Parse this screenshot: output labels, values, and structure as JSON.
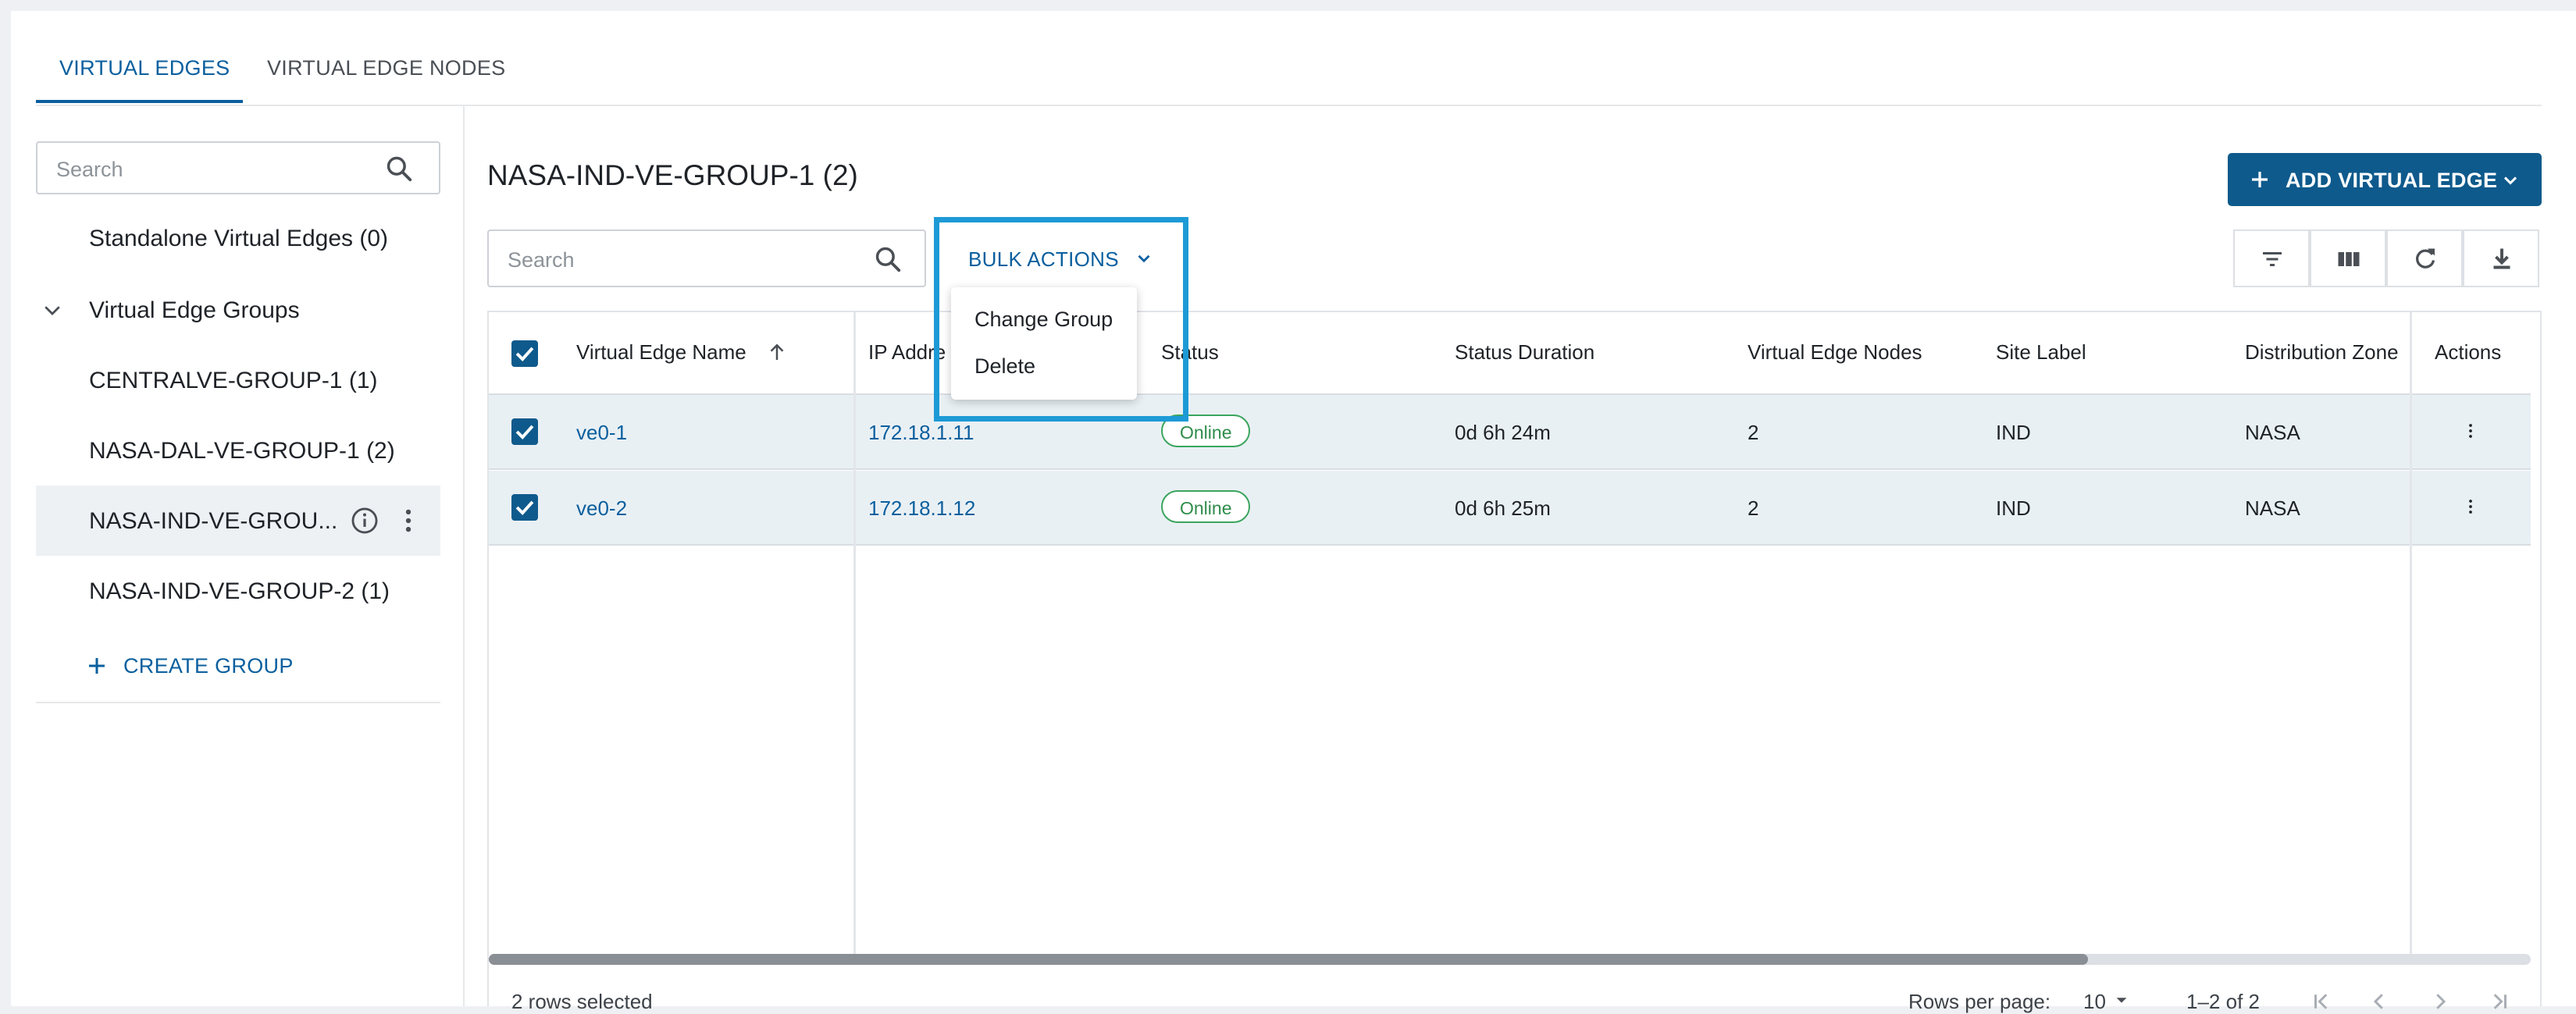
{
  "tabs": [
    {
      "label": "VIRTUAL EDGES",
      "active": true
    },
    {
      "label": "VIRTUAL EDGE NODES",
      "active": false
    }
  ],
  "sidebar": {
    "search_placeholder": "Search",
    "standalone": "Standalone Virtual Edges (0)",
    "groups_header": "Virtual Edge Groups",
    "groups": [
      {
        "label": "CENTRALVE-GROUP-1 (1)",
        "selected": false
      },
      {
        "label": "NASA-DAL-VE-GROUP-1 (2)",
        "selected": false
      },
      {
        "label": "NASA-IND-VE-GROU...",
        "selected": true
      },
      {
        "label": "NASA-IND-VE-GROUP-2 (1)",
        "selected": false
      }
    ],
    "create_group": "CREATE GROUP"
  },
  "main": {
    "title": "NASA-IND-VE-GROUP-1 (2)",
    "add_button": "ADD VIRTUAL EDGE",
    "search_placeholder": "Search",
    "bulk_actions": "BULK ACTIONS",
    "bulk_menu": [
      "Change Group",
      "Delete"
    ],
    "toolbar_icons": [
      "filter-icon",
      "columns-icon",
      "refresh-icon",
      "download-icon"
    ]
  },
  "table": {
    "columns": [
      "Virtual Edge Name",
      "IP Addre",
      "Status",
      "Status Duration",
      "Virtual Edge Nodes",
      "Site Label",
      "Distribution Zone",
      "Actions"
    ],
    "rows": [
      {
        "name": "ve0-1",
        "ip": "172.18.1.11",
        "status": "Online",
        "duration": "0d 6h 24m",
        "nodes": "2",
        "site": "IND",
        "zone": "NASA"
      },
      {
        "name": "ve0-2",
        "ip": "172.18.1.12",
        "status": "Online",
        "duration": "0d 6h 25m",
        "nodes": "2",
        "site": "IND",
        "zone": "NASA"
      }
    ],
    "selected_text": "2 rows selected",
    "rows_per_page_label": "Rows per page:",
    "rows_per_page": "10",
    "range": "1–2 of 2"
  },
  "colors": {
    "accent": "#0a5f9e",
    "primary_button": "#0f5a8c",
    "highlight": "#1d9ad6",
    "online": "#3aa55d"
  }
}
